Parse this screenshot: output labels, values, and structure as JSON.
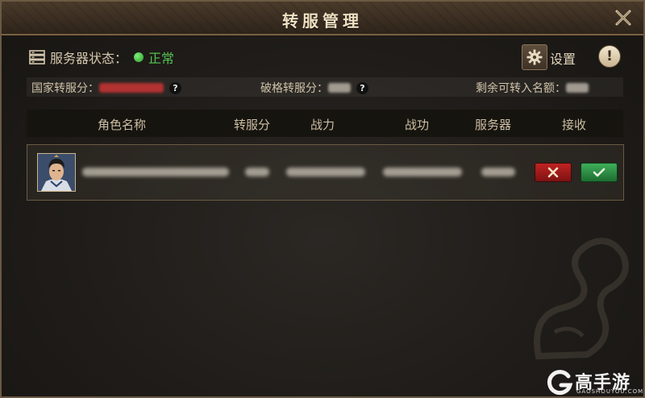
{
  "window": {
    "title": "转服管理"
  },
  "status": {
    "label": "服务器状态：",
    "value": "正常"
  },
  "toolbar": {
    "settings_label": "设置",
    "info_symbol": "!"
  },
  "quota": {
    "country_label": "国家转服分：",
    "break_label": "破格转服分：",
    "remaining_label": "剩余可转入名额：",
    "help_symbol": "?"
  },
  "table": {
    "columns": [
      "角色名称",
      "转服分",
      "战力",
      "战功",
      "服务器",
      "接收"
    ]
  },
  "colors": {
    "status_ok": "#56c14f",
    "reject": "#c02323",
    "accept": "#3fae5a",
    "title_text": "#f1e1c3"
  },
  "watermark": {
    "brand": "高手游",
    "domain": "GAOSHOUYOU.COM"
  }
}
